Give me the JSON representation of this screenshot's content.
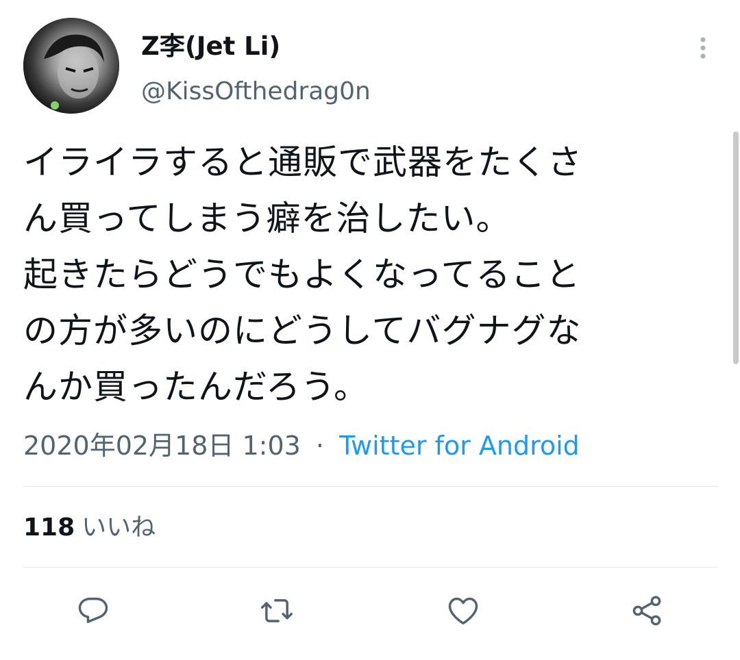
{
  "author": {
    "display_name": "Z李(Jet Li)",
    "handle": "@KissOfthedrag0n"
  },
  "tweet": {
    "lines": [
      "イライラすると通販で武器をたくさ",
      "ん買ってしまう癖を治したい。",
      "起きたらどうでもよくなってること",
      "の方が多いのにどうしてバグナグな",
      "んか買ったんだろう。"
    ],
    "timestamp": "2020年02月18日 1:03",
    "separator": "·",
    "source": "Twitter for Android"
  },
  "stats": {
    "likes_count": "118",
    "likes_label": "いいね"
  },
  "actions": {
    "icons": [
      "reply-icon",
      "retweet-icon",
      "like-icon",
      "share-icon"
    ]
  },
  "colors": {
    "text": "#0f1419",
    "secondary": "#536471",
    "link": "#1d9bf0",
    "divider": "#e6e9eb"
  }
}
